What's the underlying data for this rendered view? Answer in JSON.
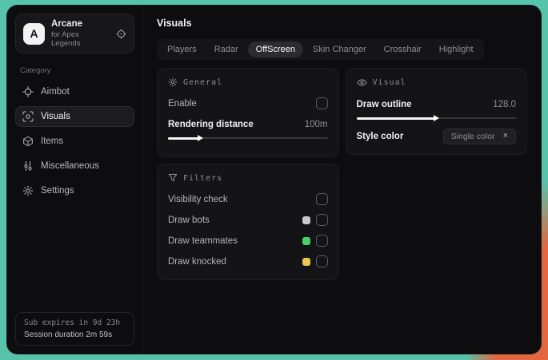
{
  "brand": {
    "logo_letter": "A",
    "title": "Arcane",
    "subtitle": "for Apex Legends"
  },
  "sidebar": {
    "category_label": "Category",
    "items": [
      {
        "label": "Aimbot",
        "icon": "crosshair-icon",
        "active": false
      },
      {
        "label": "Visuals",
        "icon": "scan-eye-icon",
        "active": true
      },
      {
        "label": "Items",
        "icon": "package-icon",
        "active": false
      },
      {
        "label": "Miscellaneous",
        "icon": "sliders-icon",
        "active": false
      },
      {
        "label": "Settings",
        "icon": "gear-icon",
        "active": false
      }
    ],
    "footer": {
      "sub_expires": "Sub expires in 9d 23h",
      "session_duration": "Session duration 2m 59s"
    }
  },
  "main": {
    "title": "Visuals",
    "tabs": [
      {
        "label": "Players",
        "active": false
      },
      {
        "label": "Radar",
        "active": false
      },
      {
        "label": "OffScreen",
        "active": true
      },
      {
        "label": "Skin Changer",
        "active": false
      },
      {
        "label": "Crosshair",
        "active": false
      },
      {
        "label": "Highlight",
        "active": false
      }
    ],
    "panels": {
      "general": {
        "title": "General",
        "enable_label": "Enable",
        "enable_checked": false,
        "rendering_label": "Rendering distance",
        "rendering_value": "100m",
        "rendering_percent": "20%"
      },
      "filters": {
        "title": "Filters",
        "rows": [
          {
            "label": "Visibility check",
            "swatch": null,
            "checked": false
          },
          {
            "label": "Draw bots",
            "swatch": "#c9c9c9",
            "checked": false
          },
          {
            "label": "Draw teammates",
            "swatch": "#47d36a",
            "checked": false
          },
          {
            "label": "Draw knocked",
            "swatch": "#e6c94e",
            "checked": false
          }
        ]
      },
      "visual": {
        "title": "Visual",
        "outline_label": "Draw outline",
        "outline_value": "128.0",
        "outline_percent": "50%",
        "style_color_label": "Style color",
        "style_color_value": "Single color",
        "clear_glyph": "×"
      }
    }
  },
  "colors": {
    "backdrop_teal": "#57c3ab",
    "backdrop_orange": "#e2663f",
    "swatch_grey": "#c9c9c9",
    "swatch_green": "#47d36a",
    "swatch_yellow": "#e6c94e",
    "window_bg": "#0d0d0f",
    "panel_bg": "#141417"
  }
}
